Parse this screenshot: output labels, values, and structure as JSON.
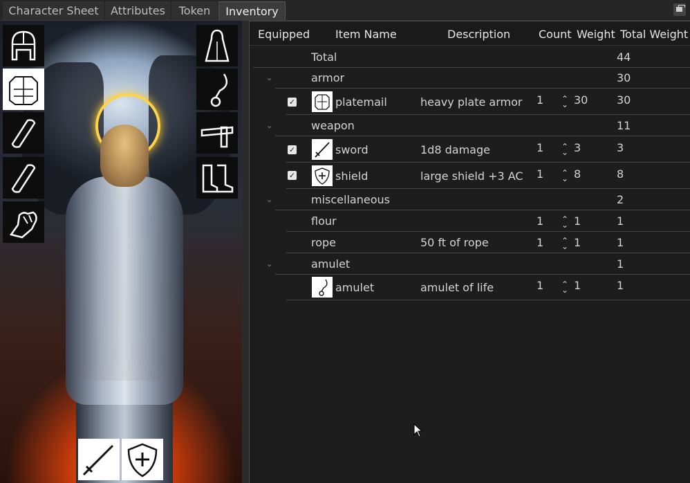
{
  "tabs": [
    {
      "label": "Character Sheet"
    },
    {
      "label": "Attributes"
    },
    {
      "label": "Token"
    },
    {
      "label": "Inventory",
      "active": true
    }
  ],
  "slots": {
    "left": [
      "helmet-icon",
      "chest-armor-icon",
      "bracer-icon",
      "bracer-icon",
      "gauntlet-icon"
    ],
    "right": [
      "cloak-icon",
      "amulet-icon",
      "belt-icon",
      "boots-icon"
    ],
    "bottom": [
      "sword-icon",
      "shield-icon"
    ]
  },
  "table": {
    "headers": {
      "equipped": "Equipped",
      "item_name": "Item Name",
      "description": "Description",
      "count": "Count",
      "weight": "Weight",
      "total_weight": "Total Weight"
    },
    "total": {
      "label": "Total",
      "total_weight": "44"
    },
    "groups": [
      {
        "name": "armor",
        "total_weight": "30"
      },
      {
        "name": "weapon",
        "total_weight": "11"
      },
      {
        "name": "miscellaneous",
        "total_weight": "2"
      },
      {
        "name": "amulet",
        "total_weight": "1"
      }
    ],
    "items": [
      {
        "name": "platemail",
        "description": "heavy plate armor",
        "count": "1",
        "weight": "30",
        "total_weight": "30",
        "equipped": true,
        "icon": "plate-armor-icon"
      },
      {
        "name": "sword",
        "description": "1d8 damage",
        "count": "1",
        "weight": "3",
        "total_weight": "3",
        "equipped": true,
        "icon": "sword-icon"
      },
      {
        "name": "shield",
        "description": "large shield +3 AC",
        "count": "1",
        "weight": "8",
        "total_weight": "8",
        "equipped": true,
        "icon": "shield-icon"
      },
      {
        "name": "flour",
        "description": "",
        "count": "1",
        "weight": "1",
        "total_weight": "1",
        "equipped": false
      },
      {
        "name": "rope",
        "description": "50 ft of rope",
        "count": "1",
        "weight": "1",
        "total_weight": "1",
        "equipped": false
      },
      {
        "name": "amulet",
        "description": "amulet of life",
        "count": "1",
        "weight": "1",
        "total_weight": "1",
        "equipped": false,
        "icon": "amulet-icon"
      }
    ]
  },
  "colors": {
    "panel_bg": "#1d1d1d",
    "row_line": "#3d4a3a",
    "text": "#d4d4d4"
  }
}
